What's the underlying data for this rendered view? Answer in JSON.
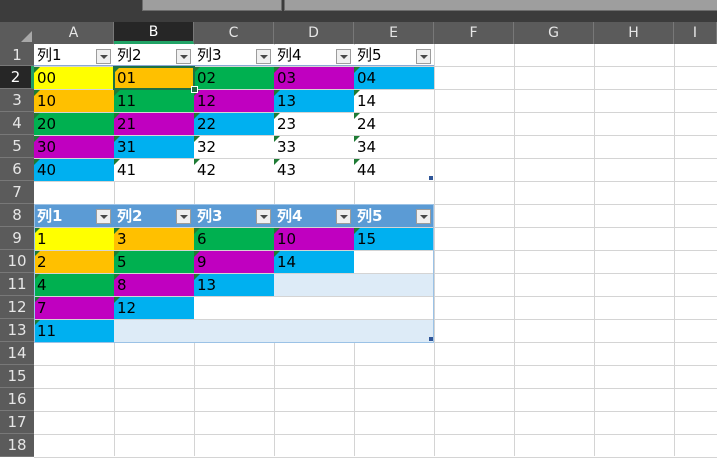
{
  "colors": {
    "yellow": "#ffff00",
    "orange": "#ffc000",
    "green": "#00b050",
    "purple": "#c000c0",
    "blue": "#00b0f0",
    "white": "#ffffff",
    "table2_header": "#5b9bd5",
    "table2_band": "#ddebf7",
    "active_accent": "#21a366"
  },
  "sheet": {
    "columns": [
      "A",
      "B",
      "C",
      "D",
      "E",
      "F",
      "G",
      "H",
      "I"
    ],
    "rows": [
      "1",
      "2",
      "3",
      "4",
      "5",
      "6",
      "7",
      "8",
      "9",
      "10",
      "11",
      "12",
      "13",
      "14",
      "15",
      "16",
      "17",
      "18"
    ],
    "active_column": "B",
    "active_row": "2",
    "selected_cell": "B2"
  },
  "table1": {
    "headers": [
      "列1",
      "列2",
      "列3",
      "列4",
      "列5"
    ],
    "rows": [
      [
        {
          "v": "00",
          "c": "yellow"
        },
        {
          "v": "01",
          "c": "orange"
        },
        {
          "v": "02",
          "c": "green"
        },
        {
          "v": "03",
          "c": "purple"
        },
        {
          "v": "04",
          "c": "blue"
        }
      ],
      [
        {
          "v": "10",
          "c": "orange"
        },
        {
          "v": "11",
          "c": "green"
        },
        {
          "v": "12",
          "c": "purple"
        },
        {
          "v": "13",
          "c": "blue"
        },
        {
          "v": "14",
          "c": "white"
        }
      ],
      [
        {
          "v": "20",
          "c": "green"
        },
        {
          "v": "21",
          "c": "purple"
        },
        {
          "v": "22",
          "c": "blue"
        },
        {
          "v": "23",
          "c": "white"
        },
        {
          "v": "24",
          "c": "white"
        }
      ],
      [
        {
          "v": "30",
          "c": "purple"
        },
        {
          "v": "31",
          "c": "blue"
        },
        {
          "v": "32",
          "c": "white"
        },
        {
          "v": "33",
          "c": "white"
        },
        {
          "v": "34",
          "c": "white"
        }
      ],
      [
        {
          "v": "40",
          "c": "blue"
        },
        {
          "v": "41",
          "c": "white"
        },
        {
          "v": "42",
          "c": "white"
        },
        {
          "v": "43",
          "c": "white"
        },
        {
          "v": "44",
          "c": "white"
        }
      ]
    ]
  },
  "table2": {
    "headers": [
      "列1",
      "列2",
      "列3",
      "列4",
      "列5"
    ],
    "rows": [
      [
        {
          "v": "1",
          "c": "yellow"
        },
        {
          "v": "3",
          "c": "orange"
        },
        {
          "v": "6",
          "c": "green"
        },
        {
          "v": "10",
          "c": "purple"
        },
        {
          "v": "15",
          "c": "blue"
        }
      ],
      [
        {
          "v": "2",
          "c": "orange"
        },
        {
          "v": "5",
          "c": "green"
        },
        {
          "v": "9",
          "c": "purple"
        },
        {
          "v": "14",
          "c": "blue"
        },
        {
          "v": "",
          "c": "white"
        }
      ],
      [
        {
          "v": "4",
          "c": "green"
        },
        {
          "v": "8",
          "c": "purple"
        },
        {
          "v": "13",
          "c": "blue"
        },
        {
          "v": "",
          "c": "band"
        },
        {
          "v": "",
          "c": "band"
        }
      ],
      [
        {
          "v": "7",
          "c": "purple"
        },
        {
          "v": "12",
          "c": "blue"
        },
        {
          "v": "",
          "c": "white"
        },
        {
          "v": "",
          "c": "white"
        },
        {
          "v": "",
          "c": "white"
        }
      ],
      [
        {
          "v": "11",
          "c": "blue"
        },
        {
          "v": "",
          "c": "band"
        },
        {
          "v": "",
          "c": "band"
        },
        {
          "v": "",
          "c": "band"
        },
        {
          "v": "",
          "c": "band"
        }
      ]
    ]
  }
}
